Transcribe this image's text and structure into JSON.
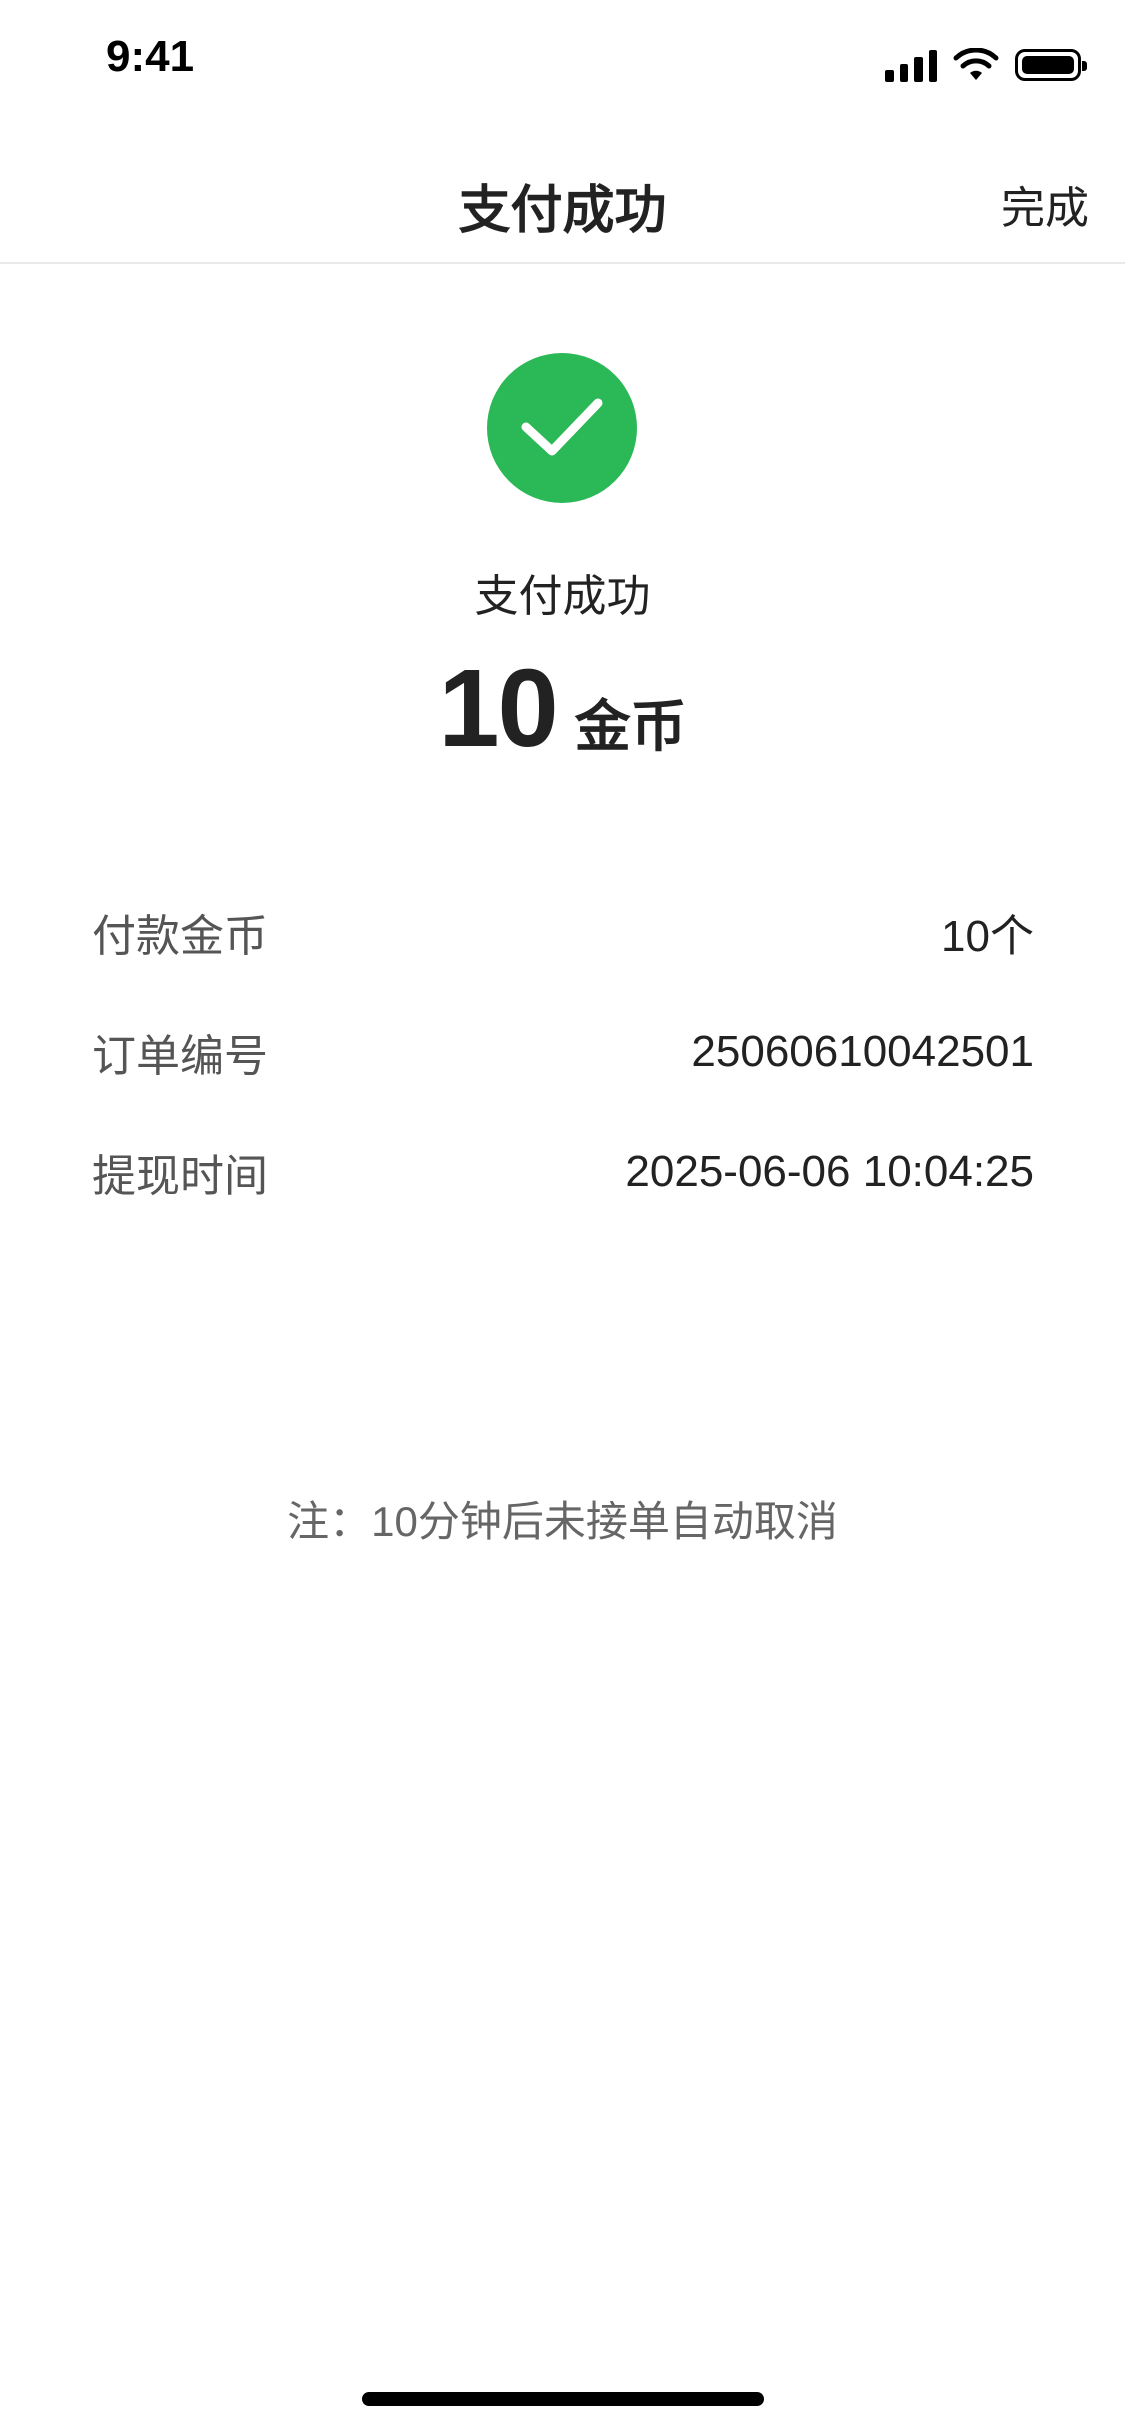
{
  "status_bar": {
    "time": "9:41",
    "icons": [
      "signal-icon",
      "wifi-icon",
      "battery-icon"
    ]
  },
  "nav": {
    "title": "支付成功",
    "done_label": "完成"
  },
  "result": {
    "icon": "check-icon",
    "status_text": "支付成功",
    "amount": "10",
    "unit": "金币",
    "accent_color": "#2bb856"
  },
  "details": [
    {
      "label": "付款金币",
      "value": "10个"
    },
    {
      "label": "订单编号",
      "value": "25060610042501"
    },
    {
      "label": "提现时间",
      "value": "2025-06-06 10:04:25"
    }
  ],
  "note": "注：10分钟后未接单自动取消"
}
